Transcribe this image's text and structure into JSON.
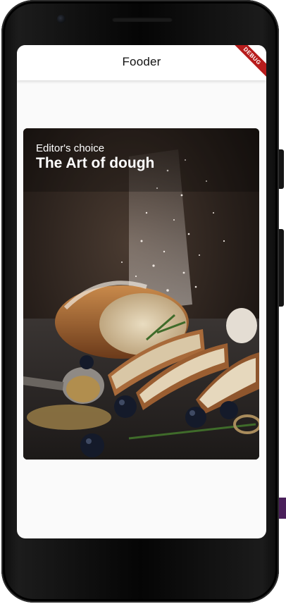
{
  "app": {
    "title": "Fooder",
    "debug_banner": "DEBUG"
  },
  "card": {
    "subtitle": "Editor's choice",
    "title": "The Art of dough",
    "image": "bread-photo"
  },
  "colors": {
    "appbar_bg": "#ffffff",
    "debug_banner": "#b71c1c",
    "card_text": "#ffffff"
  }
}
